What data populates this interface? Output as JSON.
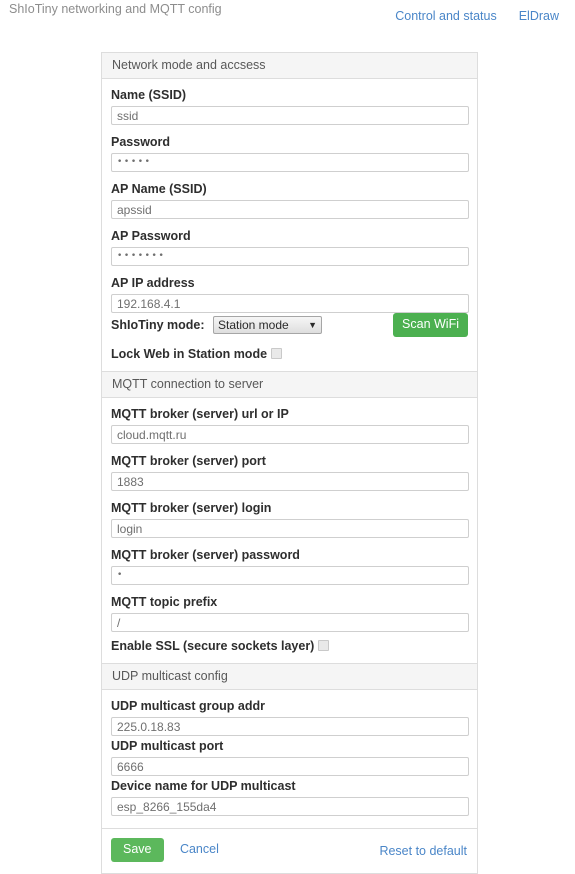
{
  "header": {
    "title": "ShIoTiny networking and MQTT config",
    "nav": [
      {
        "label": "Control and status"
      },
      {
        "label": "ElDraw"
      }
    ]
  },
  "colors": {
    "link": "#4a86c8",
    "scan_button": "#4cb050",
    "save_button": "#5cb85c",
    "panel_head_bg": "#f5f5f5",
    "panel_border": "#dddddd",
    "title_text": "#8d8d8d"
  },
  "network_panel": {
    "heading": "Network mode and accsess",
    "ssid": {
      "label": "Name (SSID)",
      "value": "ssid"
    },
    "password": {
      "label": "Password",
      "value": "•••••"
    },
    "ap_ssid": {
      "label": "AP Name (SSID)",
      "value": "apssid"
    },
    "ap_password": {
      "label": "AP Password",
      "value": "•••••••"
    },
    "ap_ip": {
      "label": "AP IP address",
      "value": "192.168.4.1"
    },
    "mode": {
      "label": "ShIoTiny mode:",
      "selected": "Station mode",
      "caret": "▼"
    },
    "scan_button": {
      "label": "Scan WiFi"
    },
    "lock_web": {
      "label": "Lock Web in Station mode",
      "checked": false
    }
  },
  "mqtt_panel": {
    "heading": "MQTT connection to server",
    "broker_url": {
      "label": "MQTT broker (server) url or IP",
      "value": "cloud.mqtt.ru"
    },
    "broker_port": {
      "label": "MQTT broker (server) port",
      "value": "1883"
    },
    "broker_login": {
      "label": "MQTT broker (server) login",
      "value": "login"
    },
    "broker_password": {
      "label": "MQTT broker (server) password",
      "value": "•"
    },
    "topic_prefix": {
      "label": "MQTT topic prefix",
      "value": "/"
    },
    "enable_ssl": {
      "label": "Enable SSL (secure sockets layer)",
      "checked": false
    }
  },
  "udp_panel": {
    "heading": "UDP multicast config",
    "group_addr": {
      "label": "UDP multicast group addr",
      "value": "225.0.18.83"
    },
    "port": {
      "label": "UDP multicast port",
      "value": "6666"
    },
    "device_name": {
      "label": "Device name for UDP multicast",
      "value": "esp_8266_155da4"
    }
  },
  "footer": {
    "save_label": "Save",
    "cancel_label": "Cancel",
    "reset_label": "Reset to default"
  }
}
